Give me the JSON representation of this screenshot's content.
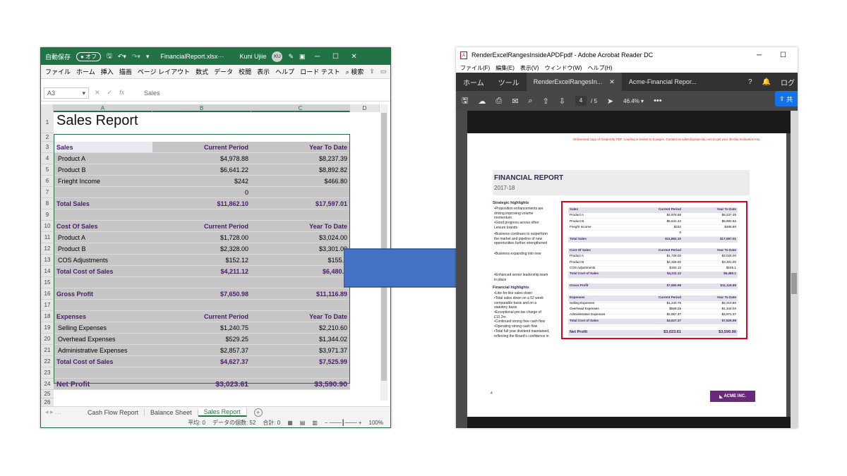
{
  "excel": {
    "autosave_label": "自動保存",
    "autosave_state": "オフ",
    "filename": "FinancialReport.xlsx···",
    "user_name": "Kuni Ujiie",
    "user_initials": "KU",
    "menu": [
      "ファイル",
      "ホーム",
      "挿入",
      "描画",
      "ページ レイアウト",
      "数式",
      "データ",
      "校閲",
      "表示",
      "ヘルプ",
      "ロード テスト"
    ],
    "search_label": "検索",
    "name_box": "A3",
    "formula_value": "Sales",
    "columns": [
      "A",
      "B",
      "C",
      "D"
    ],
    "row_numbers": [
      "1",
      "2",
      "3",
      "4",
      "5",
      "6",
      "7",
      "8",
      "9",
      "10",
      "11",
      "12",
      "13",
      "14",
      "15",
      "16",
      "17",
      "18",
      "19",
      "20",
      "21",
      "22",
      "23",
      "24",
      "25",
      "26",
      "27"
    ],
    "sheet_title": "Sales Report",
    "rows": [
      {
        "a": "Sales",
        "b": "Current Period",
        "c": "Year To Date"
      },
      {
        "a": "Product A",
        "b": "$4,978.88",
        "c": "$8,237.39"
      },
      {
        "a": "Product B",
        "b": "$6,641.22",
        "c": "$8,892.82"
      },
      {
        "a": "Frieght Income",
        "b": "$242",
        "c": "$466.80"
      },
      {
        "a": "",
        "b": "0",
        "c": ""
      },
      {
        "a": "Total Sales",
        "b": "$11,862.10",
        "c": "$17,597.01"
      },
      {
        "a": "",
        "b": "",
        "c": ""
      },
      {
        "a": "Cost Of Sales",
        "b": "Current Period",
        "c": "Year To Date"
      },
      {
        "a": "Product A",
        "b": "$1,728.00",
        "c": "$3,024.00"
      },
      {
        "a": "Product B",
        "b": "$2,328.00",
        "c": "$3,301.00"
      },
      {
        "a": "COS Adjustments",
        "b": "$152.12",
        "c": "$155.1"
      },
      {
        "a": "Total Cost of Sales",
        "b": "$4,211.12",
        "c": "$6,480.1"
      },
      {
        "a": "",
        "b": "",
        "c": ""
      },
      {
        "a": "Gross Profit",
        "b": "$7,650.98",
        "c": "$11,116.89"
      },
      {
        "a": "",
        "b": "",
        "c": ""
      },
      {
        "a": "Expenses",
        "b": "Current Period",
        "c": "Year To Date"
      },
      {
        "a": "Selling Expenses",
        "b": "$1,240.75",
        "c": "$2,210.60"
      },
      {
        "a": "Overhead Expenses",
        "b": "$529.25",
        "c": "$1,344.02"
      },
      {
        "a": "Administrative Expenses",
        "b": "$2,857.37",
        "c": "$3,971.37"
      },
      {
        "a": "Total Cost of Sales",
        "b": "$4,627.37",
        "c": "$7,525.99"
      },
      {
        "a": "",
        "b": "",
        "c": ""
      },
      {
        "a": "Net Profit",
        "b": "$3,023.61",
        "c": "$3,590.90"
      }
    ],
    "tabs": [
      "Cash Flow Report",
      "Balance Sheet",
      "Sales Report"
    ],
    "status": {
      "average": "平均: 0",
      "count": "データの個数: 52",
      "sum": "合計: 0",
      "zoom": "100%"
    }
  },
  "acrobat": {
    "title": "RenderExcelRangesInsideAPDFpdf - Adobe Acrobat Reader DC",
    "menu": [
      "ファイル(F)",
      "編集(E)",
      "表示(V)",
      "ウィンドウ(W)",
      "ヘルプ(H)"
    ],
    "home_tab": "ホーム",
    "tools_tab": "ツール",
    "doc_tab": "RenderExcelRangesIn...",
    "doc_tab2": "Acme-Financial Repor...",
    "login_label": "ログ",
    "share_label": "共",
    "current_page": "4",
    "total_pages": "/ 5",
    "zoom": "46.4%",
    "watermark": "Unlicensed copy of GrapeCity PDF. Loading is limited to 5 pages. Contact us sales@grapecity.com to get your 30-day evaluation key.",
    "report_title": "FINANCIAL REPORT",
    "report_year": "2017-18",
    "strategic_head": "Strategic highlights",
    "strategic_items": [
      "•Proposition enhancements are driving improving volume momentum",
      "•Good progress across other Leisure brands",
      "•Business continues to outperform the market and pipeline of new opportunities further strengthened",
      "•Business expanding into new"
    ],
    "enhanced_item": "•Enhanced senior leadership team in place",
    "financial_head": "Financial highlights",
    "financial_items": [
      "•Like-for-like sales down",
      "•Total sales down on a 52 week comparable basis and on a statutory basis",
      "•Exceptional pre-tax charge of £13.2m",
      "•Continued strong free cash flow",
      "•Operating strong cash flow",
      "•Total full year dividend maintained, reflecting the Board's confidence in"
    ],
    "page_number": "4",
    "logo_text": "ACME INC."
  }
}
